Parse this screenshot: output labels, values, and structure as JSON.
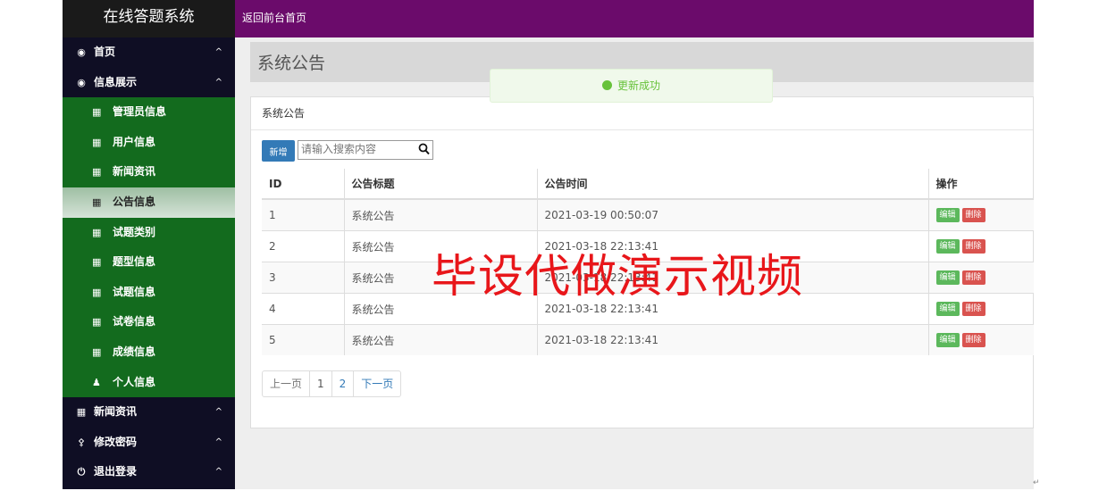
{
  "app": {
    "title": "在线答题系统"
  },
  "topbar": {
    "link": "返回前台首页"
  },
  "sidebar": {
    "items_top": [
      {
        "label": "首页",
        "icon": "dashboard-icon",
        "chevron": "^"
      },
      {
        "label": "信息展示",
        "icon": "dashboard-icon",
        "chevron": "^"
      }
    ],
    "submenu": [
      {
        "label": "管理员信息",
        "icon": "table-icon"
      },
      {
        "label": "用户信息",
        "icon": "table-icon"
      },
      {
        "label": "新闻资讯",
        "icon": "table-icon"
      },
      {
        "label": "公告信息",
        "icon": "table-icon",
        "active": true
      },
      {
        "label": "试题类别",
        "icon": "table-icon"
      },
      {
        "label": "题型信息",
        "icon": "table-icon"
      },
      {
        "label": "试题信息",
        "icon": "table-icon"
      },
      {
        "label": "试卷信息",
        "icon": "table-icon"
      },
      {
        "label": "成绩信息",
        "icon": "table-icon"
      },
      {
        "label": "个人信息",
        "icon": "user-icon"
      }
    ],
    "items_bottom": [
      {
        "label": "新闻资讯",
        "icon": "table-icon",
        "chevron": "^"
      },
      {
        "label": "修改密码",
        "icon": "lock-icon",
        "chevron": "^"
      },
      {
        "label": "退出登录",
        "icon": "power-icon",
        "chevron": "^"
      }
    ]
  },
  "page": {
    "title": "系统公告"
  },
  "toast": {
    "message": "更新成功",
    "color": "#67c23a"
  },
  "panel": {
    "heading": "系统公告",
    "add_button": "新增",
    "search_placeholder": "请输入搜索内容"
  },
  "table": {
    "columns": [
      "ID",
      "公告标题",
      "公告时间",
      "操作"
    ],
    "rows": [
      {
        "id": "1",
        "title": "系统公告",
        "time": "2021-03-19 00:50:07",
        "edit": "编辑",
        "delete": "删除"
      },
      {
        "id": "2",
        "title": "系统公告",
        "time": "2021-03-18 22:13:41",
        "edit": "编辑",
        "delete": "删除"
      },
      {
        "id": "3",
        "title": "系统公告",
        "time": "2021-03-18 22:13:41",
        "edit": "编辑",
        "delete": "删除"
      },
      {
        "id": "4",
        "title": "系统公告",
        "time": "2021-03-18 22:13:41",
        "edit": "编辑",
        "delete": "删除"
      },
      {
        "id": "5",
        "title": "系统公告",
        "time": "2021-03-18 22:13:41",
        "edit": "编辑",
        "delete": "删除"
      }
    ]
  },
  "pagination": {
    "prev": "上一页",
    "pages": [
      "1",
      "2"
    ],
    "next": "下一页"
  },
  "watermark": {
    "text": "毕设代做演示视频",
    "color": "#e8161a"
  },
  "corner_mark": "↵",
  "colors": {
    "sidebar": "#0f0e24",
    "submenu": "#136b1e",
    "topbar": "#6b0b6b",
    "primary": "#337ab7",
    "success": "#5cb85c",
    "danger": "#d9534f"
  }
}
